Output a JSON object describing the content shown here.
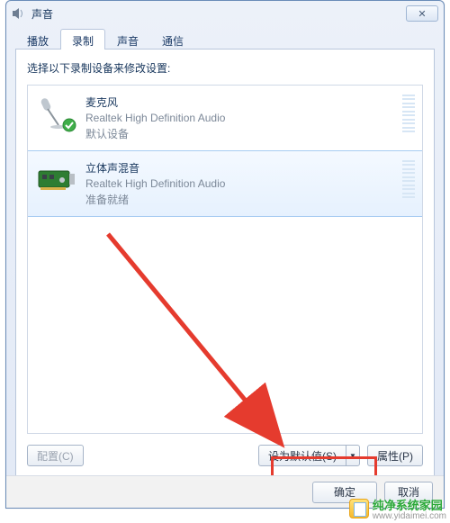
{
  "dialog": {
    "title": "声音",
    "close_label": "✕"
  },
  "tabs": [
    {
      "label": "播放",
      "active": false
    },
    {
      "label": "录制",
      "active": true
    },
    {
      "label": "声音",
      "active": false
    },
    {
      "label": "通信",
      "active": false
    }
  ],
  "instruction": "选择以下录制设备来修改设置:",
  "devices": [
    {
      "name": "麦克风",
      "driver": "Realtek High Definition Audio",
      "status": "默认设备",
      "selected": false,
      "default": true,
      "icon": "mic"
    },
    {
      "name": "立体声混音",
      "driver": "Realtek High Definition Audio",
      "status": "准备就绪",
      "selected": true,
      "default": false,
      "icon": "soundcard"
    }
  ],
  "buttons": {
    "configure": "配置(C)",
    "set_default": "设为默认值(S)",
    "properties": "属性(P)",
    "dropdown_glyph": "▼"
  },
  "footer": {
    "ok": "确定",
    "cancel": "取消"
  },
  "watermark": {
    "text": "纯净系统家园",
    "url": "www.yidaimei.com"
  }
}
